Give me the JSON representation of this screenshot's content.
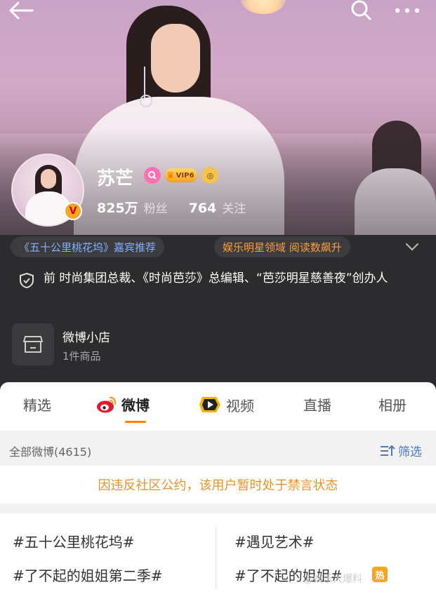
{
  "profile": {
    "name": "苏芒",
    "vip_level": "VIP6",
    "followers_count": "825万",
    "followers_label": "粉丝",
    "following_count": "764",
    "following_label": "关注"
  },
  "tags": {
    "guest_tag": "《五十公里桃花坞》嘉宾推荐",
    "domain_tag": "娱乐明星领域 阅读数飙升"
  },
  "bio": "前 时尚集团总裁、《时尚芭莎》总编辑、“芭莎明星慈善夜”创办人",
  "shop": {
    "title": "微博小店",
    "subtitle": "1件商品"
  },
  "tabs": [
    {
      "label": "精选"
    },
    {
      "label": "微博"
    },
    {
      "label": "视频"
    },
    {
      "label": "直播"
    },
    {
      "label": "相册"
    }
  ],
  "feed": {
    "all_label": "全部微博(4615)",
    "filter_label": "筛选",
    "ban_notice": "因违反社区公约，该用户暂时处于禁言状态"
  },
  "topics": [
    "#五十公里桃花坞#",
    "#遇见艺术#",
    "#了不起的姐姐第二季#",
    "#了不起的姐姐#"
  ],
  "hot_badge": "热",
  "watermark": "@娱乐大爆料",
  "colors": {
    "accent_orange": "#ff8200",
    "link_blue": "#4a79c7",
    "notice_orange": "#e8932a"
  }
}
